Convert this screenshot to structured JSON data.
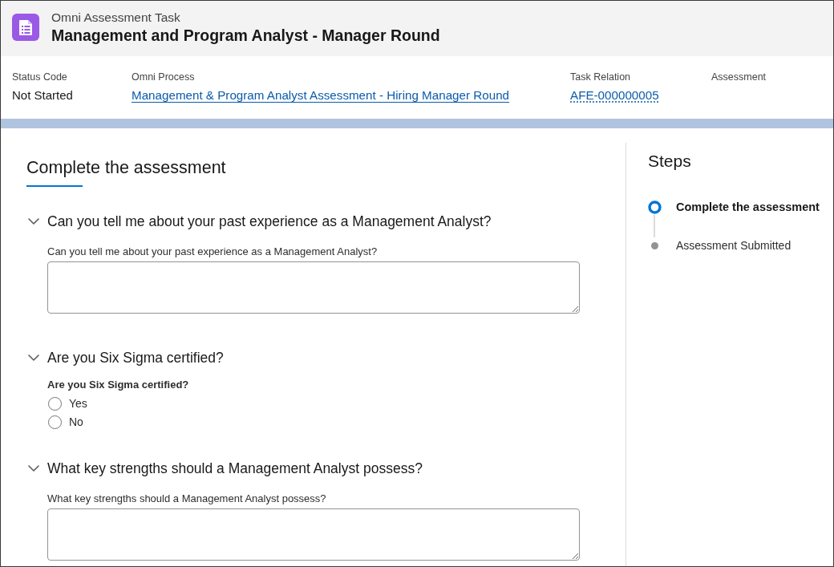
{
  "header": {
    "object_type": "Omni Assessment Task",
    "title": "Management and Program Analyst - Manager Round"
  },
  "fields": [
    {
      "label": "Status Code",
      "kind": "text",
      "value": "Not Started"
    },
    {
      "label": "Omni Process",
      "kind": "link",
      "value": "Management & Program Analyst Assessment - Hiring Manager Round"
    },
    {
      "label": "Task Relation",
      "kind": "lookup",
      "value": "AFE-000000005"
    },
    {
      "label": "Assessment"
    }
  ],
  "assessment": {
    "title": "Complete the assessment",
    "questions": [
      {
        "kind": "textarea",
        "heading": "Can you tell me about your past experience as a Management Analyst?",
        "expanded": true,
        "label": "Can you tell me about your past experience as a Management Analyst?"
      },
      {
        "kind": "radio",
        "heading": "Are you Six Sigma certified?",
        "expanded": true,
        "label": "Are you Six Sigma certified?",
        "options": [
          {
            "label": "Yes",
            "selected": false
          },
          {
            "label": "No",
            "selected": false
          }
        ]
      },
      {
        "kind": "textarea",
        "heading": "What key strengths should a Management Analyst possess?",
        "expanded": true,
        "label": "What key strengths should a Management Analyst possess?"
      }
    ]
  },
  "steps": {
    "title": "Steps",
    "items": [
      {
        "label": "Complete the assessment",
        "current": true
      },
      {
        "label": "Assessment Submitted",
        "current": false
      }
    ]
  }
}
